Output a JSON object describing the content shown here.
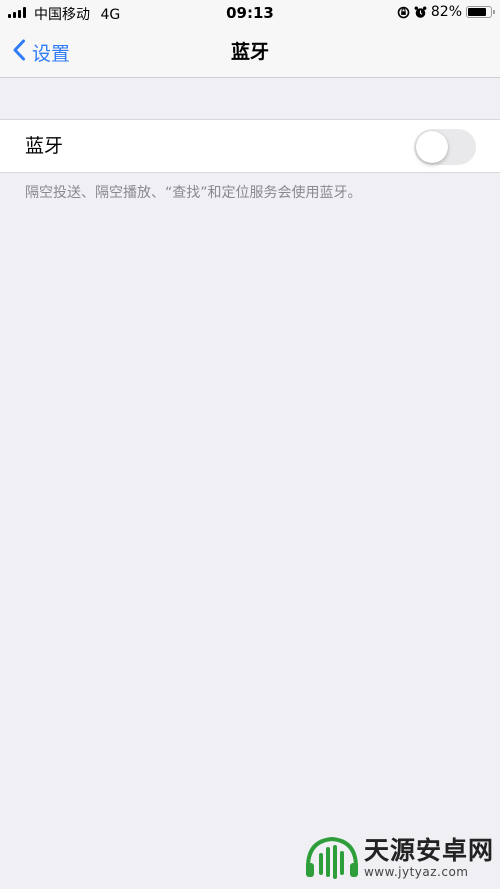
{
  "status_bar": {
    "carrier": "中国移动",
    "network": "4G",
    "time": "09:13",
    "battery_percent": "82%",
    "battery_level": 0.82,
    "icons": [
      "signal-icon",
      "orientation-lock-icon",
      "alarm-icon",
      "battery-icon"
    ]
  },
  "nav": {
    "back_label": "设置",
    "title": "蓝牙",
    "back_icon": "chevron-left-icon"
  },
  "bluetooth": {
    "label": "蓝牙",
    "enabled": false,
    "description": "隔空投送、隔空播放、“查找”和定位服务会使用蓝牙。"
  },
  "watermark": {
    "name": "天源安卓网",
    "url": "www.jytyaz.com"
  },
  "colors": {
    "accent": "#2f7cf6",
    "background": "#efeff4",
    "toggle_off": "#e9e9eb",
    "secondary_text": "#8a8a8e"
  }
}
